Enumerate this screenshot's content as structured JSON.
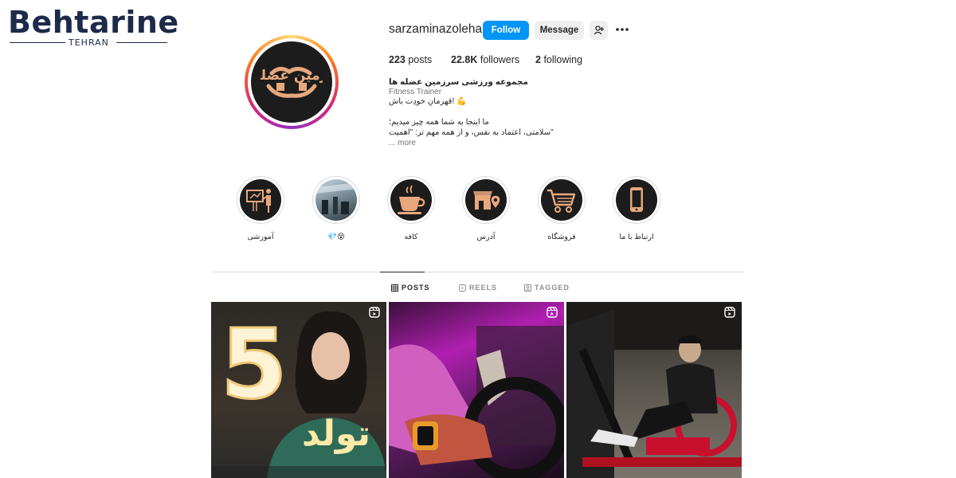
{
  "watermark": {
    "brand": "Behtarine",
    "city": "TEHRAN"
  },
  "profile": {
    "username": "sarzaminazoleha",
    "avatar_text": "سرزمین عضله ها",
    "follow_label": "Follow",
    "message_label": "Message",
    "posts_count": "223",
    "posts_label": "posts",
    "followers_count": "22.8K",
    "followers_label": "followers",
    "following_count": "2",
    "following_label": "following",
    "display_name": "مجموعه ورزشی سرزمین عضله ها",
    "category": "Fitness Trainer",
    "bio_line1": "قهرمانِ خودِت باش! 💪",
    "bio_line2": "ما اینجا به شما همه چیز میدیم؛",
    "bio_line3": "سلامتی، اعتماد به نفس، و از همه مهم تر: \"اهمیت\"",
    "more_label": "... more"
  },
  "highlights": [
    {
      "label": "آموزشی",
      "icon": "teacher-board-icon"
    },
    {
      "label": "💎😵",
      "icon": "gym-photo"
    },
    {
      "label": "کافه",
      "icon": "coffee-cup-icon"
    },
    {
      "label": "آدرس",
      "icon": "location-shop-icon"
    },
    {
      "label": "فروشگاه",
      "icon": "shopping-cart-icon"
    },
    {
      "label": "ارتباط با ما",
      "icon": "phone-icon"
    }
  ],
  "tabs": {
    "posts": "POSTS",
    "reels": "REELS",
    "tagged": "TAGGED"
  },
  "posts": [
    {
      "overlay_number": "5",
      "overlay_text": "تولد",
      "reel": true
    },
    {
      "reel": true
    },
    {
      "reel": true
    }
  ],
  "colors": {
    "accent": "#0095f6",
    "text": "#262626",
    "muted": "#737373",
    "highlight_icon": "#e8a87c"
  }
}
